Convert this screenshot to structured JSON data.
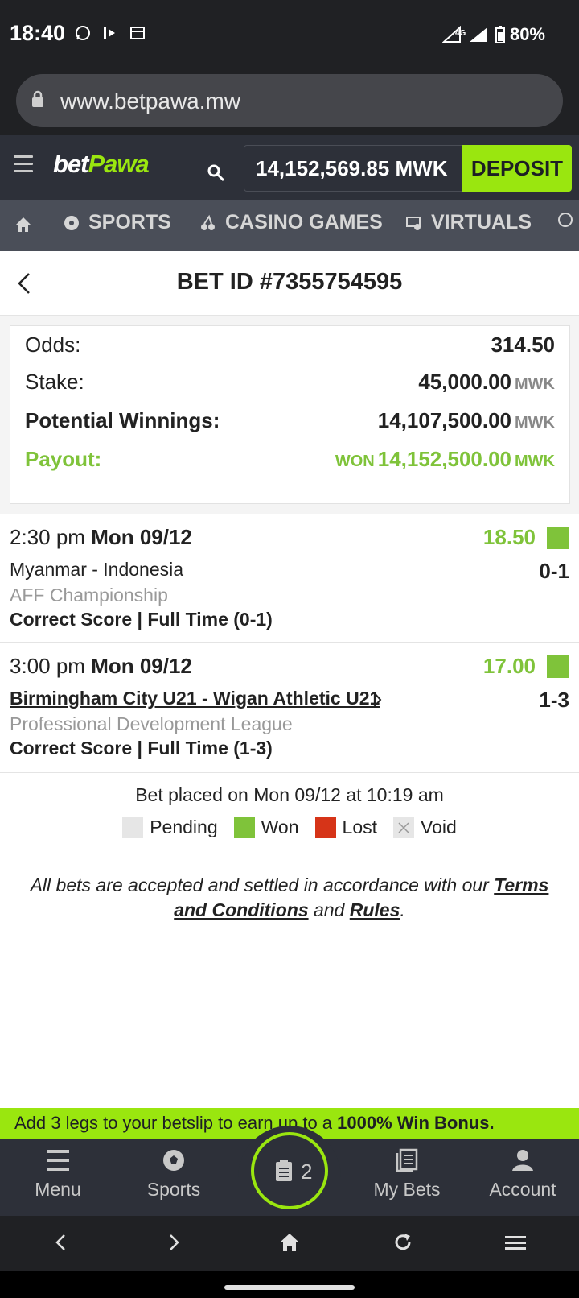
{
  "status": {
    "time": "18:40",
    "battery": "80%"
  },
  "browser": {
    "url": "www.betpawa.mw"
  },
  "header": {
    "logo_bet": "bet",
    "logo_pawa": "Pawa",
    "balance": "14,152,569.85 MWK",
    "deposit": "DEPOSIT"
  },
  "nav": {
    "sports": "SPORTS",
    "casino": "CASINO GAMES",
    "virtuals": "VIRTUALS"
  },
  "bet": {
    "title": "BET ID #7355754595",
    "odds_label": "Odds:",
    "odds": "314.50",
    "stake_label": "Stake:",
    "stake": "45,000.00",
    "potential_label": "Potential Winnings:",
    "potential": "14,107,500.00",
    "payout_label": "Payout:",
    "payout_status": "WON",
    "payout": "14,152,500.00",
    "currency": "MWK"
  },
  "matches": [
    {
      "time": "2:30 pm",
      "date": "Mon 09/12",
      "odd": "18.50",
      "teams": "Myanmar - Indonesia",
      "score": "0-1",
      "league": "AFF Championship",
      "market": "Correct Score | Full Time (0-1)",
      "status_color": "#7fc33a"
    },
    {
      "time": "3:00 pm",
      "date": "Mon 09/12",
      "odd": "17.00",
      "teams": "Birmingham City U21 - Wigan Athletic U21",
      "score": "1-3",
      "league": "Professional Development League",
      "market": "Correct Score | Full Time (1-3)",
      "status_color": "#7fc33a"
    }
  ],
  "placed": "Bet placed on Mon 09/12 at 10:19 am",
  "legend": {
    "pending": "Pending",
    "won": "Won",
    "lost": "Lost",
    "void": "Void"
  },
  "colors": {
    "pending": "#e6e6e6",
    "won": "#7fc33a",
    "lost": "#d63418",
    "accent": "#9ae60f"
  },
  "terms": {
    "text1": "All bets are accepted and settled in accordance with our ",
    "link1": "Terms and Conditions",
    "text2": " and ",
    "link2": "Rules",
    "text3": "."
  },
  "bonus": {
    "text": "Add 3 legs to your betslip to earn up to a ",
    "bold": "1000% Win Bonus."
  },
  "bottom_nav": {
    "menu": "Menu",
    "sports": "Sports",
    "betslip_count": "2",
    "my_bets": "My Bets",
    "account": "Account"
  }
}
